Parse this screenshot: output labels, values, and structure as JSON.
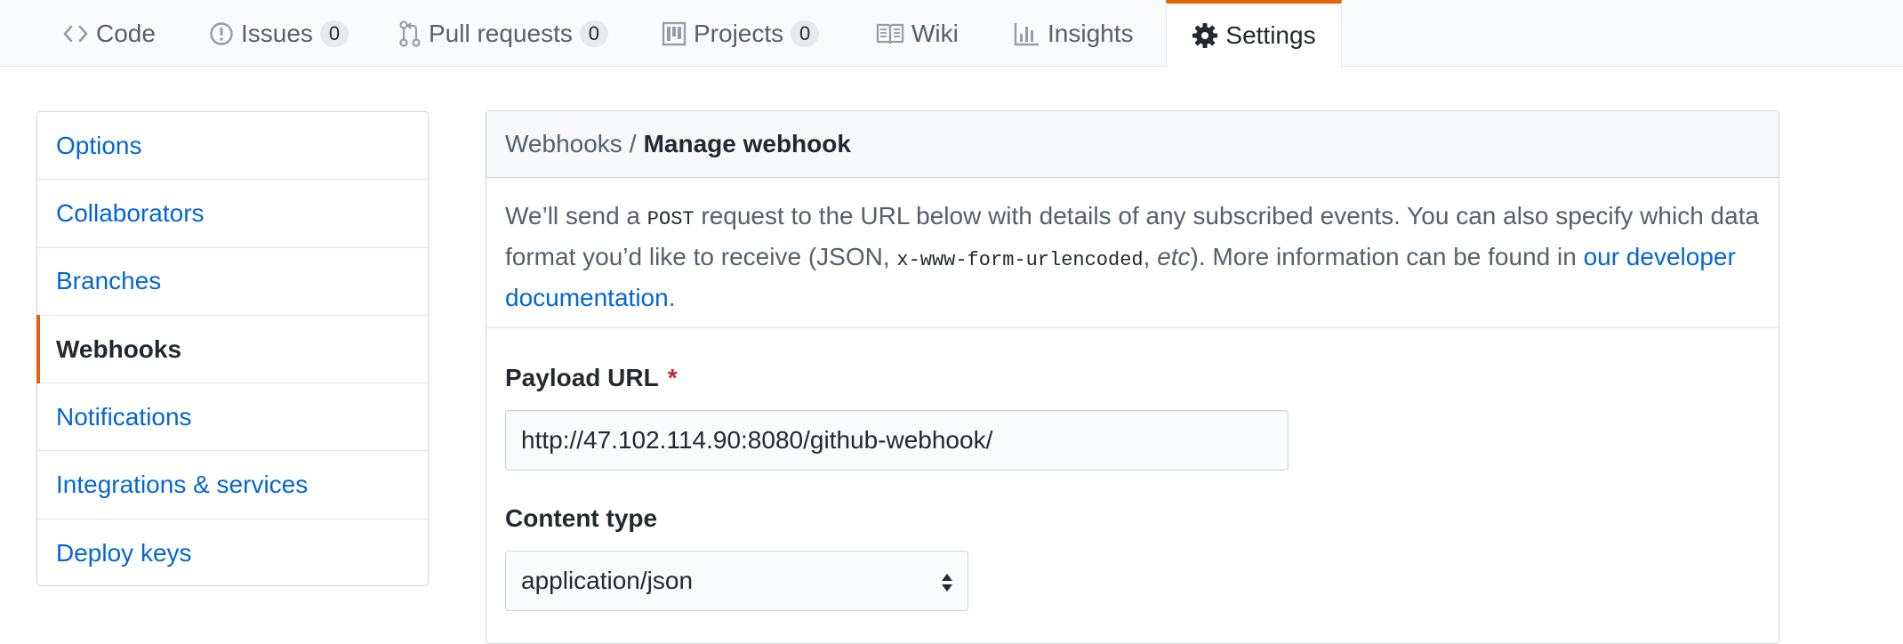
{
  "nav": {
    "tabs": [
      {
        "label": "Code",
        "icon": "code-icon"
      },
      {
        "label": "Issues",
        "icon": "issue-opened-icon",
        "count": "0"
      },
      {
        "label": "Pull requests",
        "icon": "git-pull-request-icon",
        "count": "0"
      },
      {
        "label": "Projects",
        "icon": "project-icon",
        "count": "0"
      },
      {
        "label": "Wiki",
        "icon": "book-icon"
      },
      {
        "label": "Insights",
        "icon": "graph-icon"
      },
      {
        "label": "Settings",
        "icon": "gear-icon",
        "selected": true
      }
    ]
  },
  "sidebar": {
    "items": [
      {
        "label": "Options"
      },
      {
        "label": "Collaborators"
      },
      {
        "label": "Branches"
      },
      {
        "label": "Webhooks",
        "selected": true
      },
      {
        "label": "Notifications"
      },
      {
        "label": "Integrations & services"
      },
      {
        "label": "Deploy keys"
      }
    ]
  },
  "main": {
    "breadcrumb_parent": "Webhooks",
    "breadcrumb_separator": "/",
    "breadcrumb_current": "Manage webhook",
    "description": {
      "part1": "We’ll send a ",
      "method": "POST",
      "part2": " request to the URL below with details of any subscribed events. You can also specify which data format you’d like to receive (JSON, ",
      "encoding": "x-www-form-urlencoded",
      "part3": ", ",
      "etc": "etc",
      "part4": "). More information can be found in ",
      "link": "our developer documentation",
      "part5": "."
    },
    "payload_url_label": "Payload URL",
    "required_marker": "*",
    "payload_url_value": "http://47.102.114.90:8080/github-webhook/",
    "content_type_label": "Content type",
    "content_type_value": "application/json"
  },
  "colors": {
    "accent": "#e36209",
    "link": "#0366d6",
    "required": "#cb2431"
  }
}
